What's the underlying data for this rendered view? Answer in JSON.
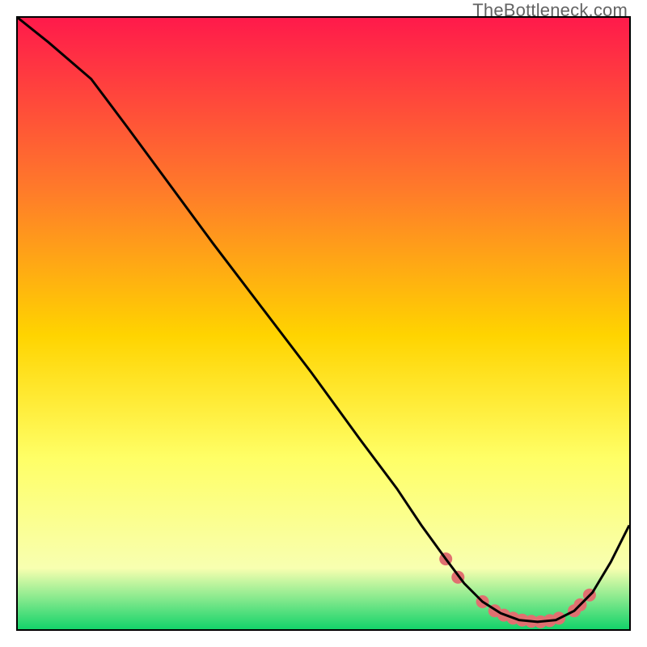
{
  "watermark": "TheBottleneck.com",
  "chart_data": {
    "type": "line",
    "title": "",
    "xlabel": "",
    "ylabel": "",
    "xlim": [
      0,
      100
    ],
    "ylim": [
      0,
      100
    ],
    "background_gradient": {
      "top": "#ff1a4b",
      "mid1": "#ff7a2a",
      "mid2": "#ffd400",
      "mid3": "#ffff66",
      "mid4": "#f8ffb0",
      "bottom": "#13d36a"
    },
    "series": [
      {
        "name": "bottleneck-curve",
        "color": "#000000",
        "x": [
          0,
          5,
          12,
          18,
          25,
          32,
          40,
          48,
          56,
          62,
          66,
          70,
          73,
          76,
          79,
          82,
          85,
          88,
          91,
          94,
          97,
          100
        ],
        "y": [
          100,
          96,
          90,
          82,
          72.5,
          63,
          52.5,
          42,
          31,
          23,
          17,
          11.5,
          7.5,
          4.5,
          2.6,
          1.5,
          1.2,
          1.5,
          3,
          6,
          11,
          17
        ]
      }
    ],
    "markers": {
      "name": "highlight-dots",
      "color": "#e07070",
      "radius": 8,
      "points": [
        {
          "x": 70,
          "y": 11.5
        },
        {
          "x": 72,
          "y": 8.5
        },
        {
          "x": 76,
          "y": 4.5
        },
        {
          "x": 78,
          "y": 3.0
        },
        {
          "x": 79.5,
          "y": 2.3
        },
        {
          "x": 81,
          "y": 1.8
        },
        {
          "x": 82.5,
          "y": 1.5
        },
        {
          "x": 84,
          "y": 1.3
        },
        {
          "x": 85.5,
          "y": 1.2
        },
        {
          "x": 87,
          "y": 1.4
        },
        {
          "x": 88.5,
          "y": 1.8
        },
        {
          "x": 91,
          "y": 3.0
        },
        {
          "x": 92,
          "y": 4.0
        },
        {
          "x": 93.5,
          "y": 5.6
        }
      ]
    }
  }
}
